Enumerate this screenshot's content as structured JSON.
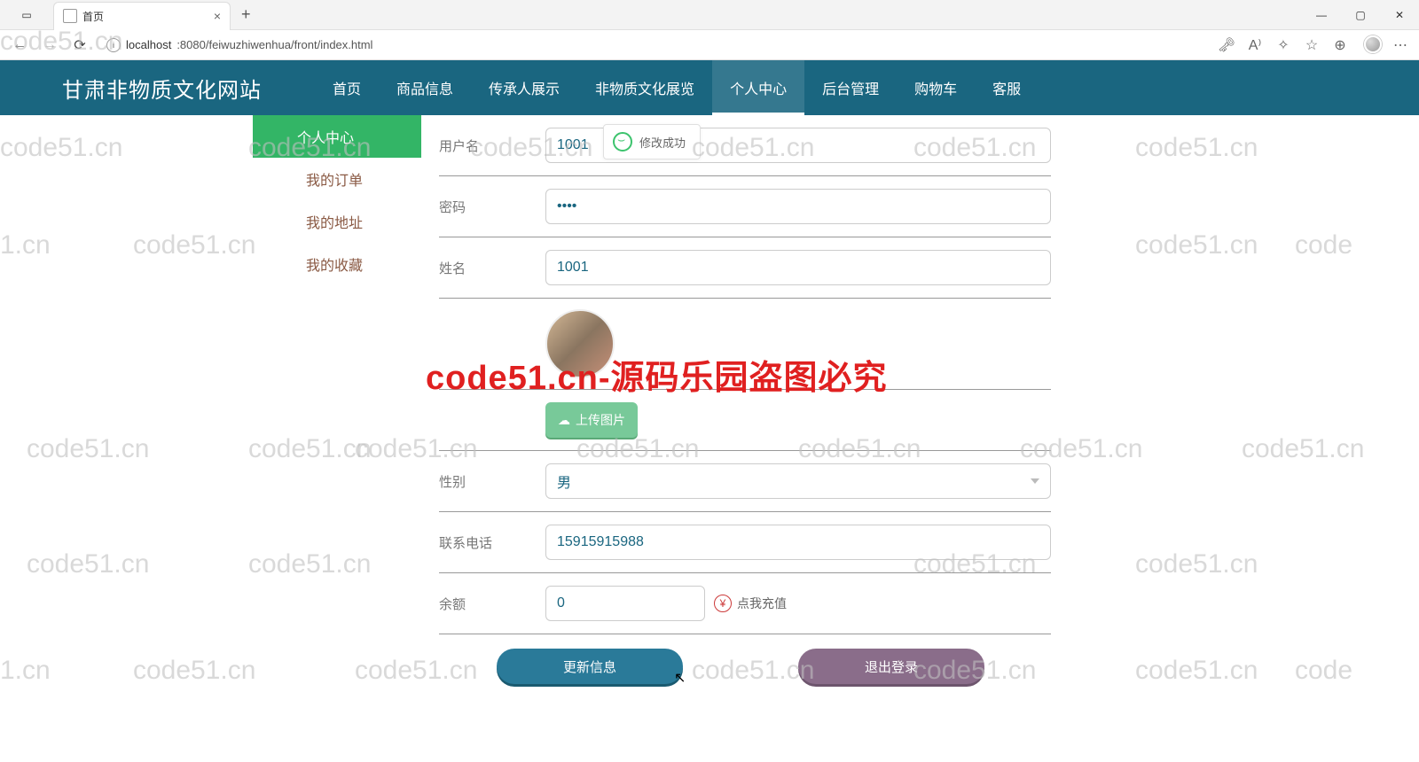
{
  "browser": {
    "tab_title": "首页",
    "url": "localhost:8080/feiwuzhiwenhua/front/index.html",
    "url_host": "localhost",
    "url_rest": ":8080/feiwuzhiwenhua/front/index.html"
  },
  "topnav": {
    "brand": "甘肃非物质文化网站",
    "items": [
      "首页",
      "商品信息",
      "传承人展示",
      "非物质文化展览",
      "个人中心",
      "后台管理",
      "购物车",
      "客服"
    ],
    "active_index": 4
  },
  "toast": {
    "text": "修改成功"
  },
  "sidebar": {
    "items": [
      "个人中心",
      "我的订单",
      "我的地址",
      "我的收藏"
    ],
    "active_index": 0
  },
  "form": {
    "username": {
      "label": "用户名",
      "value": "1001"
    },
    "password": {
      "label": "密码",
      "value": "••••"
    },
    "name": {
      "label": "姓名",
      "value": "1001"
    },
    "upload": {
      "label": "上传图片"
    },
    "gender": {
      "label": "性别",
      "value": "男"
    },
    "phone": {
      "label": "联系电话",
      "value": "15915915988"
    },
    "balance": {
      "label": "余额",
      "value": "0",
      "recharge_text": "点我充值"
    }
  },
  "buttons": {
    "update": "更新信息",
    "logout": "退出登录"
  },
  "watermark": {
    "text": "code51.cn",
    "big": "code51.cn-源码乐园盗图必究"
  }
}
